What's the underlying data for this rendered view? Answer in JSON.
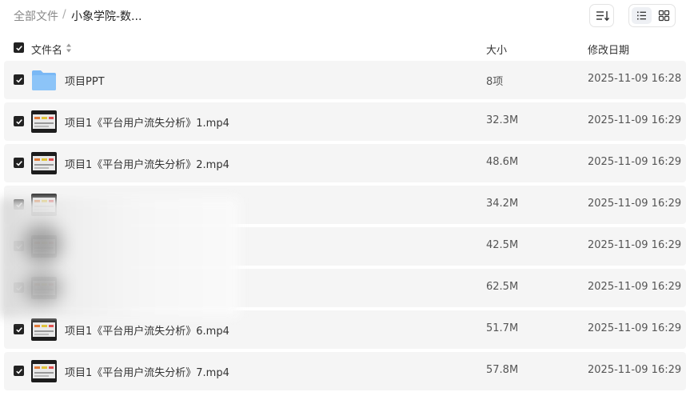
{
  "breadcrumb": {
    "root": "全部文件",
    "separator": "/",
    "current": "小象学院-数..."
  },
  "toolbar": {
    "sort_icon": "sort-icon",
    "list_view_icon": "list-view-icon",
    "grid_view_icon": "grid-view-icon",
    "active_view": "list"
  },
  "table": {
    "columns": {
      "name": "文件名",
      "size": "大小",
      "modified": "修改日期"
    },
    "rows": [
      {
        "name": "项目PPT",
        "size": "8项",
        "date": "2025-11-09 16:28",
        "type": "folder",
        "checked": true
      },
      {
        "name": "项目1《平台用户流失分析》1.mp4",
        "size": "32.3M",
        "date": "2025-11-09 16:29",
        "type": "video",
        "checked": true
      },
      {
        "name": "项目1《平台用户流失分析》2.mp4",
        "size": "48.6M",
        "date": "2025-11-09 16:29",
        "type": "video",
        "checked": true
      },
      {
        "name": "",
        "size": "34.2M",
        "date": "2025-11-09 16:29",
        "type": "video",
        "checked": true
      },
      {
        "name": "",
        "size": "42.5M",
        "date": "2025-11-09 16:29",
        "type": "video",
        "checked": true
      },
      {
        "name": "",
        "size": "62.5M",
        "date": "2025-11-09 16:29",
        "type": "video",
        "checked": true
      },
      {
        "name": "项目1《平台用户流失分析》6.mp4",
        "size": "51.7M",
        "date": "2025-11-09 16:29",
        "type": "video",
        "checked": true
      },
      {
        "name": "项目1《平台用户流失分析》7.mp4",
        "size": "57.8M",
        "date": "2025-11-09 16:29",
        "type": "video",
        "checked": true
      }
    ]
  },
  "colors": {
    "row_bg": "#f5f5f5",
    "folder": "#7ab8f5",
    "checkbox": "#222222"
  }
}
